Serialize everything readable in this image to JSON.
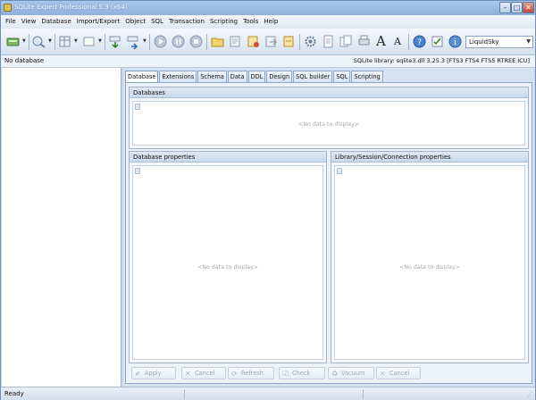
{
  "window": {
    "title": "SQLite Expert Professional 5.3 (x64)",
    "min_glyph": "–",
    "max_glyph": "□",
    "close_glyph": "✕"
  },
  "menu": [
    "File",
    "View",
    "Database",
    "Import/Export",
    "Object",
    "SQL",
    "Transaction",
    "Scripting",
    "Tools",
    "Help"
  ],
  "toolbar": {
    "skin_value": "LiquidSky",
    "font_increase_glyph": "A",
    "font_decrease_glyph": "A"
  },
  "infobar": {
    "left": "No database",
    "right": "SQLite library: sqlite3.dll 3.25.3 [FTS3 FTS4 FTS5 RTREE ICU]"
  },
  "tabs": [
    "Database",
    "Extensions",
    "Schema",
    "Data",
    "DDL",
    "Design",
    "SQL builder",
    "SQL",
    "Scripting"
  ],
  "active_tab": "Database",
  "panels": {
    "databases": {
      "title": "Databases",
      "empty": "<No data to display>"
    },
    "db_properties": {
      "title": "Database properties",
      "empty": "<No data to display>"
    },
    "lib_properties": {
      "title": "Library/Session/Connection properties",
      "empty": "<No data to display>"
    }
  },
  "actions": [
    {
      "label": "Apply",
      "icon": "✔"
    },
    {
      "label": "Cancel",
      "icon": "✕"
    },
    {
      "label": "Refresh",
      "icon": "⟳"
    },
    {
      "label": "Check",
      "icon": "☑"
    },
    {
      "label": "Vacuum",
      "icon": "♻"
    },
    {
      "label": "Cancel",
      "icon": "✕"
    }
  ],
  "status": {
    "text": "Ready"
  }
}
